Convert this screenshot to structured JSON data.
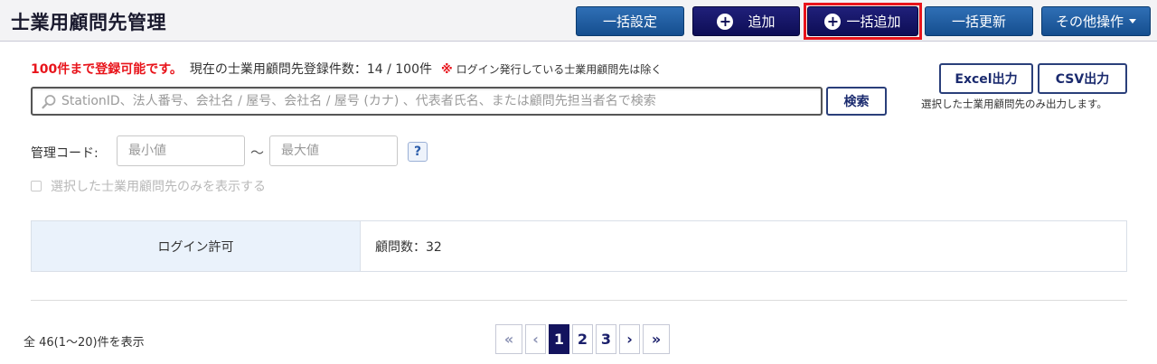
{
  "header": {
    "title": "士業用顧問先管理",
    "buttons": {
      "bulk_settings": "一括設定",
      "add": "追加",
      "bulk_add": "一括追加",
      "bulk_update": "一括更新",
      "other_ops": "その他操作"
    }
  },
  "notice": {
    "limit": "100件まで登録可能です。",
    "count": "現在の士業用顧問先登録件数：14 / 100件",
    "mark": "※",
    "note": "ログイン発行している士業用顧問先は除く"
  },
  "search": {
    "placeholder": "StationID、法人番号、会社名 / 屋号、会社名 / 屋号 (カナ) 、代表者氏名、または顧問先担当者名で検索",
    "button": "検索"
  },
  "export": {
    "excel": "Excel出力",
    "csv": "CSV出力",
    "note": "選択した士業用顧問先のみ出力します。"
  },
  "filter": {
    "code_label": "管理コード:",
    "min_placeholder": "最小値",
    "tilde": "～",
    "max_placeholder": "最大値",
    "help": "?",
    "only_selected": "選択した士業用顧問先のみを表示する"
  },
  "status": {
    "login_label": "ログイン許可",
    "clients_count": "顧問数：32"
  },
  "footer": {
    "result_text": "全 46(1～20)件を表示",
    "pages": [
      "1",
      "2",
      "3"
    ],
    "current_page": "1",
    "first": "«",
    "prev": "‹",
    "next": "›",
    "last": "»"
  },
  "colors": {
    "accent_red": "#e8141b",
    "primary_blue": "#154e8f",
    "dark_navy": "#0d0d55"
  }
}
